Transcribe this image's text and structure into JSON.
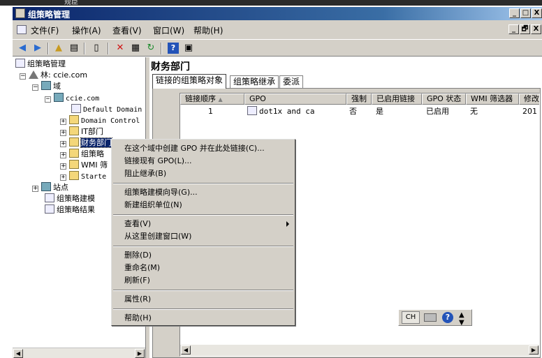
{
  "window": {
    "top_fragment": "规臣",
    "title": "组策略管理",
    "controls": {
      "minimize": "_",
      "restore": "□",
      "close": "X"
    },
    "mdi_controls": {
      "minimize": "_",
      "restore": "🗗",
      "close": "X"
    }
  },
  "menubar": {
    "items": [
      "文件(F)",
      "操作(A)",
      "查看(V)",
      "窗口(W)",
      "帮助(H)"
    ]
  },
  "toolbar": {
    "icons": [
      "back-arrow-icon",
      "forward-arrow-icon",
      "up-folder-icon",
      "show-hide-tree-icon",
      "copy-icon",
      "delete-icon",
      "properties-icon",
      "refresh-icon",
      "help-icon",
      "console-icon"
    ]
  },
  "tree": {
    "root": "组策略管理",
    "forest": "林: ccie.com",
    "domains": "域",
    "domain": "ccie.com",
    "children": [
      "Default Domain",
      "Domain Control",
      "IT部门",
      "财务部门",
      "组策略",
      "WMI 筛",
      "Starte"
    ],
    "sites": "站点",
    "modeling": "组策略建模",
    "results": "组策略结果"
  },
  "details": {
    "title": "财务部门",
    "tabs": [
      "链接的组策略对象",
      "组策略继承",
      "委派"
    ],
    "columns": [
      "链接顺序",
      "GPO",
      "强制",
      "已启用链接",
      "GPO 状态",
      "WMI 筛选器",
      "修改"
    ],
    "rows": [
      {
        "order": "1",
        "gpo": "dot1x and ca",
        "enforced": "否",
        "link_enabled": "是",
        "status": "已启用",
        "wmi": "无",
        "modified": "201"
      }
    ]
  },
  "context_menu": {
    "groups": [
      [
        "在这个域中创建 GPO 并在此处链接(C)...",
        "链接现有 GPO(L)...",
        "阻止继承(B)"
      ],
      [
        "组策略建模向导(G)...",
        "新建组织单位(N)"
      ],
      [
        "查看(V)",
        "从这里创建窗口(W)"
      ],
      [
        "删除(D)",
        "重命名(M)",
        "刷新(F)"
      ],
      [
        "属性(R)"
      ],
      [
        "帮助(H)"
      ]
    ]
  },
  "language_bar": {
    "lang": "CH"
  }
}
